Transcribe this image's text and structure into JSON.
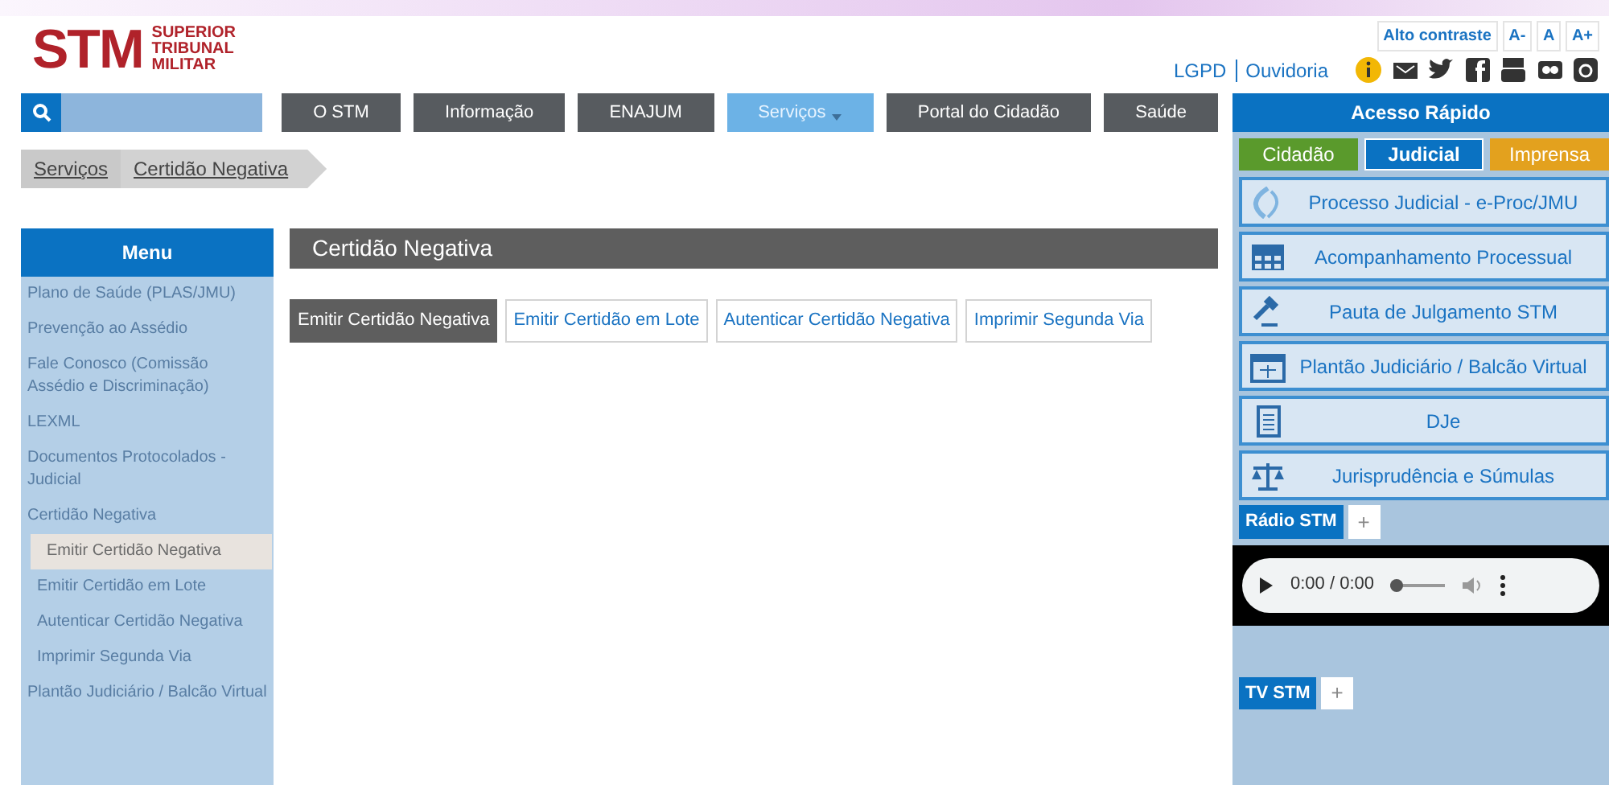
{
  "logo": {
    "mark": "STM",
    "lines": [
      "SUPERIOR",
      "TRIBUNAL",
      "MILITAR"
    ]
  },
  "accessibility": [
    "Alto contraste",
    "A-",
    "A",
    "A+"
  ],
  "top_links": [
    "LGPD",
    "Ouvidoria"
  ],
  "social": [
    {
      "kind": "info"
    },
    {
      "kind": "mail"
    },
    {
      "kind": "bird"
    },
    {
      "kind": "f"
    },
    {
      "kind": "tube"
    },
    {
      "kind": "dots"
    },
    {
      "kind": "camera"
    }
  ],
  "nav": [
    {
      "label": "O STM",
      "selected": false,
      "dropdown": false
    },
    {
      "label": "Informação",
      "selected": false,
      "dropdown": false
    },
    {
      "label": "ENAJUM",
      "selected": false,
      "dropdown": false
    },
    {
      "label": "Serviços",
      "selected": true,
      "dropdown": true
    },
    {
      "label": "Portal do Cidadão",
      "selected": false,
      "dropdown": false
    },
    {
      "label": "Saúde",
      "selected": false,
      "dropdown": false
    }
  ],
  "breadcrumb": [
    "Serviços",
    "Certidão Negativa"
  ],
  "menu": {
    "title": "Menu",
    "items": [
      {
        "label": "Plano de Saúde (PLAS/JMU)",
        "selected": false
      },
      {
        "label": "Prevenção ao Assédio",
        "selected": false
      },
      {
        "label": "Fale Conosco (Comissão Assédio e Discriminação)",
        "selected": false
      },
      {
        "label": "LEXML",
        "selected": false
      },
      {
        "label": "Documentos Protocolados - Judicial",
        "selected": false
      },
      {
        "label": "Certidão Negativa",
        "selected": false,
        "children": [
          {
            "label": "Emitir Certidão Negativa",
            "selected": true
          },
          {
            "label": "Emitir Certidão em Lote",
            "selected": false
          },
          {
            "label": "Autenticar Certidão Negativa",
            "selected": false
          },
          {
            "label": "Imprimir Segunda Via",
            "selected": false
          }
        ]
      },
      {
        "label": "Plantão Judiciário / Balcão Virtual",
        "selected": false
      }
    ]
  },
  "content": {
    "title": "Certidão Negativa",
    "tabs": [
      {
        "label": "Emitir Certidão Negativa",
        "selected": true
      },
      {
        "label": "Emitir Certidão em Lote",
        "selected": false
      },
      {
        "label": "Autenticar Certidão Negativa",
        "selected": false
      },
      {
        "label": "Imprimir Segunda Via",
        "selected": false
      }
    ]
  },
  "quick_access": {
    "title": "Acesso Rápido",
    "tabs": [
      {
        "label": "Cidadão",
        "selected": false,
        "color": "#5a9a2c"
      },
      {
        "label": "Judicial",
        "selected": true,
        "color": "#0a72c2"
      },
      {
        "label": "Imprensa",
        "selected": false,
        "color": "#e3a11e"
      }
    ],
    "links": [
      {
        "label": "Processo Judicial - e-Proc/JMU",
        "kind": "swirl"
      },
      {
        "label": "Acompanhamento Processual",
        "kind": "grid"
      },
      {
        "label": "Pauta de Julgamento STM",
        "kind": "gavel"
      },
      {
        "label": "Plantão Judiciário / Balcão Virtual",
        "kind": "calendar"
      },
      {
        "label": "DJe",
        "kind": "document"
      },
      {
        "label": "Jurisprudência e Súmulas",
        "kind": "scale"
      }
    ]
  },
  "radio": {
    "title": "Rádio STM",
    "expand": "+",
    "time": "0:00 / 0:00",
    "level": 0
  },
  "tv": {
    "title": "TV STM",
    "expand": "+"
  }
}
